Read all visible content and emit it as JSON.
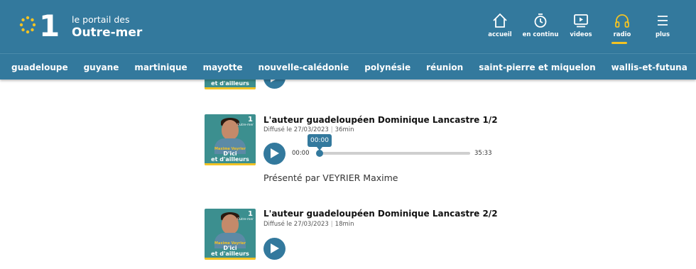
{
  "header": {
    "logo_number": "1",
    "brand_small": "le portail des",
    "brand_big": "Outre-mer",
    "nav": [
      {
        "label": "accueil",
        "icon": "home-icon"
      },
      {
        "label": "en continu",
        "icon": "timer-icon"
      },
      {
        "label": "videos",
        "icon": "video-play-icon"
      },
      {
        "label": "radio",
        "icon": "headphones-icon",
        "active": true
      },
      {
        "label": "plus",
        "icon": "menu-icon"
      }
    ]
  },
  "territories": [
    "guadeloupe",
    "guyane",
    "martinique",
    "mayotte",
    "nouvelle-calédonie",
    "polynésie",
    "réunion",
    "saint-pierre et miquelon",
    "wallis-et-futuna"
  ],
  "colors": {
    "brand": "#33799d",
    "accent": "#f3c324"
  },
  "episodes": [
    {
      "thumb_badge": "1",
      "thumb_badge_sub": "Outre-mer",
      "thumb_presenter": "Maxime Veyrier",
      "thumb_show_line1": "D'ici",
      "thumb_show_line2": "et d'ailleurs",
      "title": "L'auteur guadeloupéen Dominique Lancastre 1/2",
      "date": "Diffusé le 27/03/2023",
      "duration": "36min",
      "player": {
        "current": "00:00",
        "total": "35:33",
        "tooltip": "00:00",
        "progress": 0
      },
      "host": "Présenté par VEYRIER Maxime"
    },
    {
      "thumb_badge": "1",
      "thumb_badge_sub": "Outre-mer",
      "thumb_presenter": "Maxime Veyrier",
      "thumb_show_line1": "D'ici",
      "thumb_show_line2": "et d'ailleurs",
      "title": "L'auteur guadeloupéen Dominique Lancastre 2/2",
      "date": "Diffusé le 27/03/2023",
      "duration": "18min"
    }
  ],
  "partial_thumb_text": "et d'ailleurs"
}
